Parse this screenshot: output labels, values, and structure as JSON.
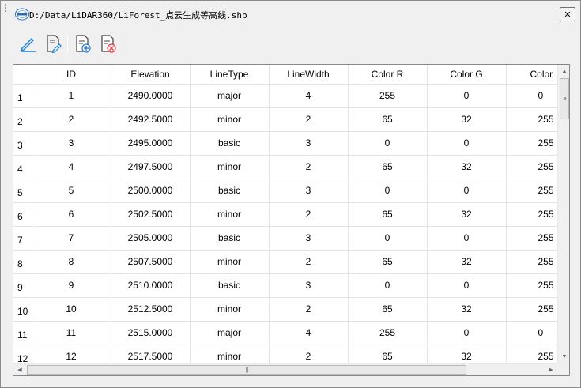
{
  "window": {
    "title": "D:/Data/LiDAR360/LiForest_点云生成等高线.shp",
    "close_label": "✕"
  },
  "toolbar": {
    "icons": [
      "edit-pencil-icon",
      "edit-attributes-icon",
      "add-field-icon",
      "delete-field-icon"
    ]
  },
  "table": {
    "columns": [
      "ID",
      "Elevation",
      "LineType",
      "LineWidth",
      "Color R",
      "Color G",
      "Color"
    ],
    "rows": [
      {
        "num": "1",
        "cells": [
          "1",
          "2490.0000",
          "major",
          "4",
          "255",
          "0",
          "0"
        ]
      },
      {
        "num": "2",
        "cells": [
          "2",
          "2492.5000",
          "minor",
          "2",
          "65",
          "32",
          "255"
        ]
      },
      {
        "num": "3",
        "cells": [
          "3",
          "2495.0000",
          "basic",
          "3",
          "0",
          "0",
          "255"
        ]
      },
      {
        "num": "4",
        "cells": [
          "4",
          "2497.5000",
          "minor",
          "2",
          "65",
          "32",
          "255"
        ]
      },
      {
        "num": "5",
        "cells": [
          "5",
          "2500.0000",
          "basic",
          "3",
          "0",
          "0",
          "255"
        ]
      },
      {
        "num": "6",
        "cells": [
          "6",
          "2502.5000",
          "minor",
          "2",
          "65",
          "32",
          "255"
        ]
      },
      {
        "num": "7",
        "cells": [
          "7",
          "2505.0000",
          "basic",
          "3",
          "0",
          "0",
          "255"
        ]
      },
      {
        "num": "8",
        "cells": [
          "8",
          "2507.5000",
          "minor",
          "2",
          "65",
          "32",
          "255"
        ]
      },
      {
        "num": "9",
        "cells": [
          "9",
          "2510.0000",
          "basic",
          "3",
          "0",
          "0",
          "255"
        ]
      },
      {
        "num": "10",
        "cells": [
          "10",
          "2512.5000",
          "minor",
          "2",
          "65",
          "32",
          "255"
        ]
      },
      {
        "num": "11",
        "cells": [
          "11",
          "2515.0000",
          "major",
          "4",
          "255",
          "0",
          "0"
        ]
      },
      {
        "num": "12",
        "cells": [
          "12",
          "2517.5000",
          "minor",
          "2",
          "65",
          "32",
          "255"
        ]
      }
    ]
  },
  "scrollbars": {
    "up_arrow": "▲",
    "down_arrow": "▼",
    "left_arrow": "◀",
    "right_arrow": "▶"
  },
  "colors": {
    "accent": "#1e7fd6",
    "delete": "#e04040",
    "grid_line": "#e3e3e3"
  }
}
